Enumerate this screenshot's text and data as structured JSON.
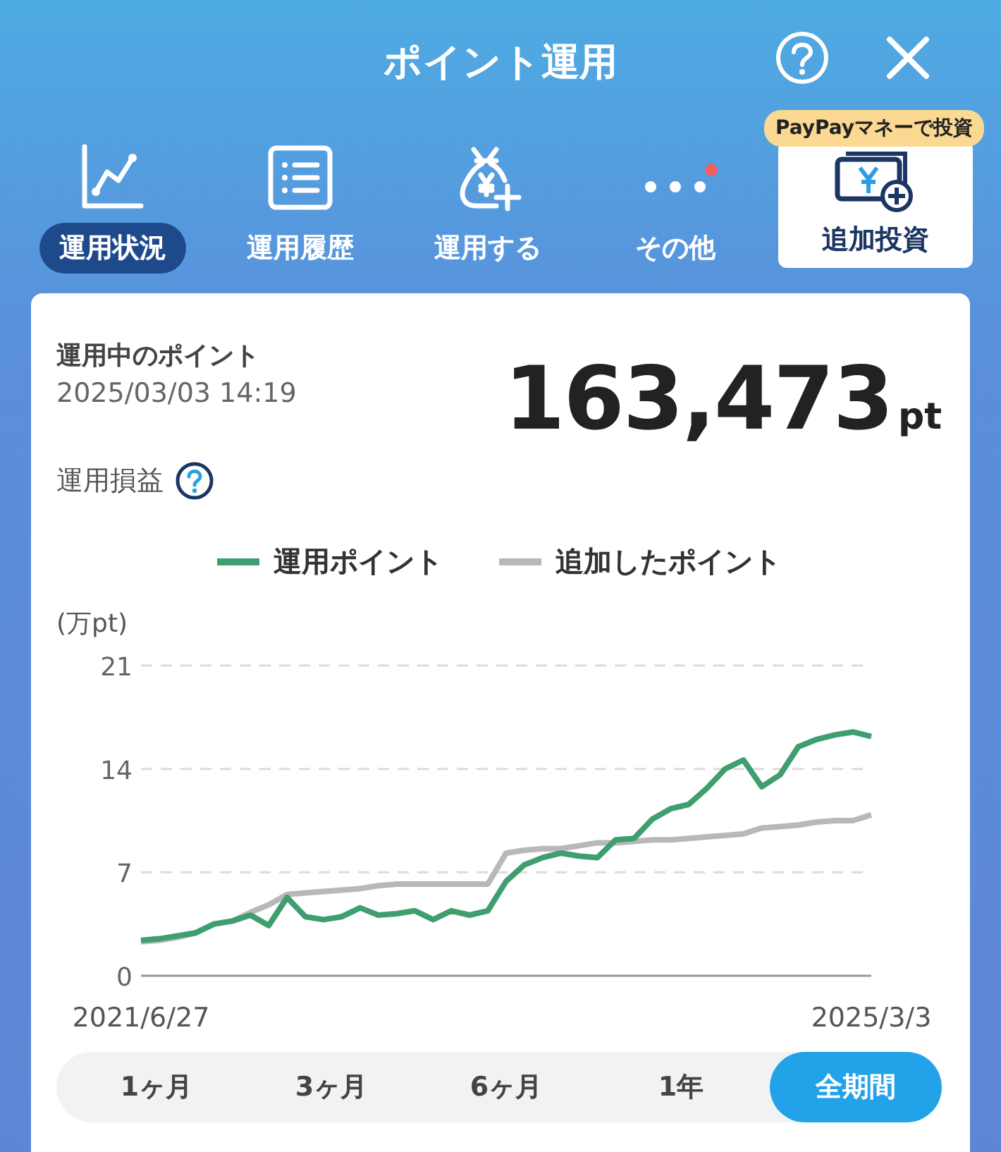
{
  "header": {
    "title": "ポイント運用"
  },
  "nav": [
    {
      "kind": "tab",
      "label": "運用状況",
      "selected": true
    },
    {
      "kind": "tab",
      "label": "運用履歴",
      "selected": false
    },
    {
      "kind": "tab",
      "label": "運用する",
      "selected": false
    },
    {
      "kind": "tab",
      "label": "その他",
      "selected": false,
      "notice": true
    },
    {
      "kind": "action",
      "label": "追加投資",
      "badge": "PayPayマネーで投資"
    }
  ],
  "summary": {
    "label": "運用中のポイント",
    "timestamp": "2025/03/03 14:19",
    "value": "163,473",
    "unit": "pt",
    "profit_label": "運用損益"
  },
  "chart_data": {
    "type": "line",
    "ylabel": "(万pt)",
    "categories": [
      "2021/6/27",
      null,
      null,
      null,
      null,
      null,
      null,
      null,
      null,
      null,
      null,
      null,
      null,
      null,
      null,
      null,
      null,
      null,
      null,
      null,
      null,
      null,
      null,
      null,
      null,
      null,
      null,
      null,
      null,
      null,
      null,
      null,
      null,
      null,
      null,
      null,
      null,
      null,
      null,
      null,
      "2025/3/3"
    ],
    "ylim": [
      0,
      21
    ],
    "yticks": [
      0,
      7,
      14,
      21
    ],
    "series": [
      {
        "name": "運用ポイント",
        "color": "#3f9e6e",
        "values": [
          2.4,
          2.5,
          2.7,
          2.9,
          3.5,
          3.7,
          4.1,
          3.4,
          5.3,
          4.0,
          3.8,
          4.0,
          4.6,
          4.1,
          4.2,
          4.4,
          3.8,
          4.4,
          4.1,
          4.4,
          6.4,
          7.5,
          8.0,
          8.3,
          8.1,
          8.0,
          9.2,
          9.3,
          10.6,
          11.3,
          11.6,
          12.7,
          14.0,
          14.6,
          12.8,
          13.6,
          15.5,
          16.0,
          16.3,
          16.5,
          16.2
        ]
      },
      {
        "name": "追加したポイント",
        "color": "#b8b8b8",
        "values": [
          2.3,
          2.4,
          2.6,
          2.9,
          3.5,
          3.7,
          4.3,
          4.8,
          5.5,
          5.6,
          5.7,
          5.8,
          5.9,
          6.1,
          6.2,
          6.2,
          6.2,
          6.2,
          6.2,
          6.2,
          8.3,
          8.5,
          8.6,
          8.6,
          8.8,
          9.0,
          9.0,
          9.1,
          9.2,
          9.2,
          9.3,
          9.4,
          9.5,
          9.6,
          10.0,
          10.1,
          10.2,
          10.4,
          10.5,
          10.5,
          10.9
        ]
      }
    ]
  },
  "periods": [
    {
      "label": "1ヶ月",
      "selected": false
    },
    {
      "label": "3ヶ月",
      "selected": false
    },
    {
      "label": "6ヶ月",
      "selected": false
    },
    {
      "label": "1年",
      "selected": false
    },
    {
      "label": "全期間",
      "selected": true
    }
  ]
}
